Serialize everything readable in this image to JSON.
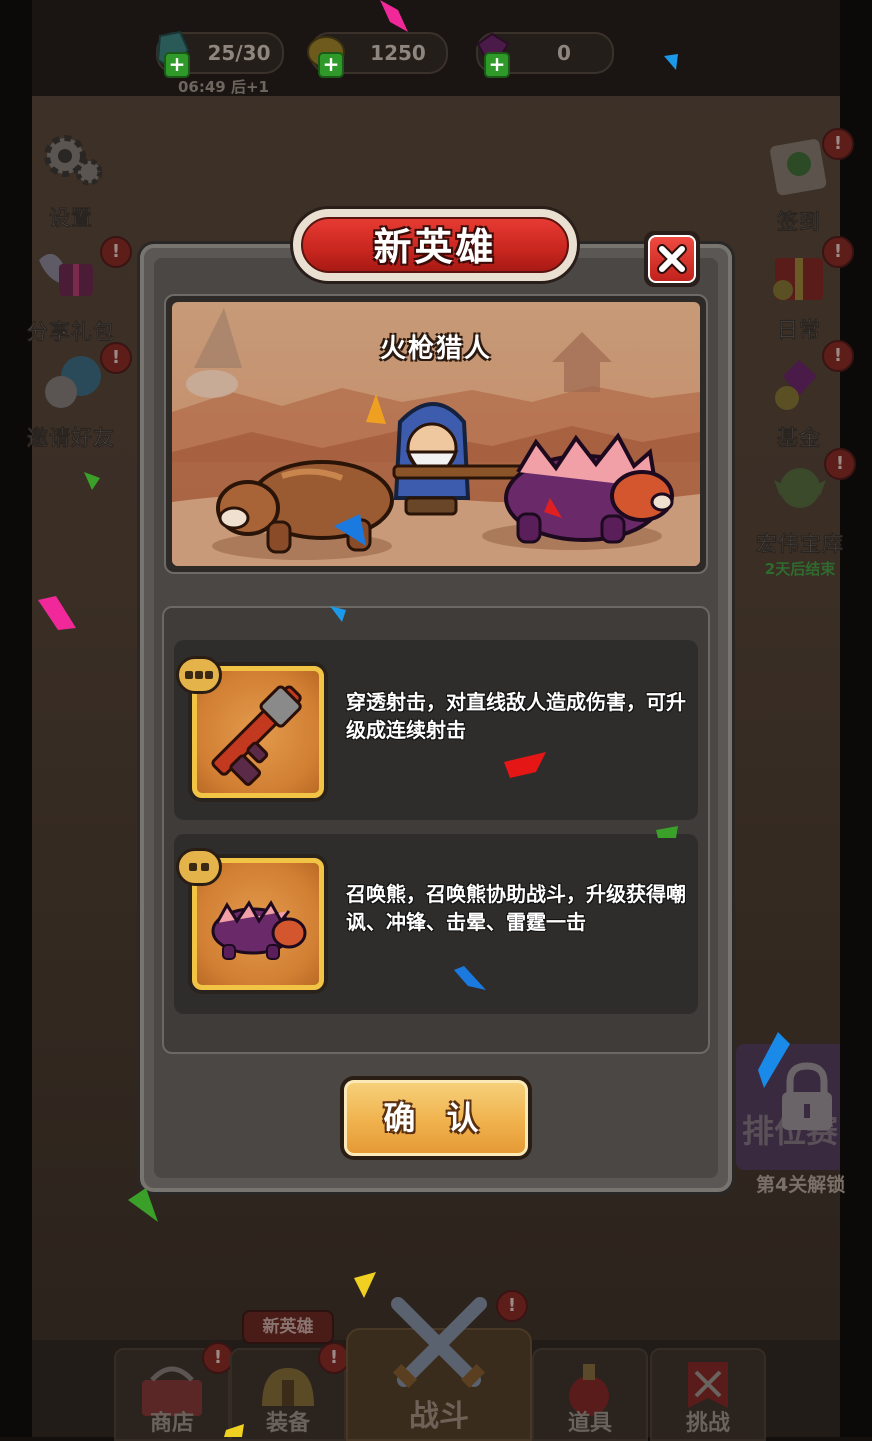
{
  "hud": {
    "energy": {
      "value": "25/30",
      "timer": "06:49 后+1"
    },
    "gold": {
      "value": "1250"
    },
    "gems": {
      "value": "0"
    }
  },
  "left_menu": {
    "settings": "设置",
    "share_gift": "分享礼包",
    "invite": "邀请好友"
  },
  "right_menu": {
    "checkin": "签到",
    "daily": "日常",
    "fund": "基金",
    "treasure": "宏伟宝库",
    "treasure_sub": "2天后结束"
  },
  "ranked": {
    "label": "排位赛",
    "unlock": "第4关解锁"
  },
  "bottom_nav": {
    "shop": "商店",
    "equip": "装备",
    "equip_tag": "新英雄",
    "fight": "战斗",
    "items": "道具",
    "challenge": "挑战"
  },
  "badge_mark": "!",
  "modal": {
    "title": "新英雄",
    "hero_name": "火枪猎人",
    "skills": [
      {
        "desc": "穿透射击，对直线敌人造成伤害，可升级成连续射击",
        "pips": 3,
        "icon": "rifle-icon"
      },
      {
        "desc": "召唤熊，召唤熊协助战斗，升级获得嘲讽、冲锋、击晕、雷霆一击",
        "pips": 2,
        "icon": "armored-bear-icon"
      }
    ],
    "confirm": "确 认"
  },
  "colors": {
    "title_red": "#d9302a",
    "card_gold": "#f2c445",
    "card_orange": "#d17f33",
    "confirm_gold": "#f0b24d",
    "buff_green": "#2f9a2a"
  }
}
